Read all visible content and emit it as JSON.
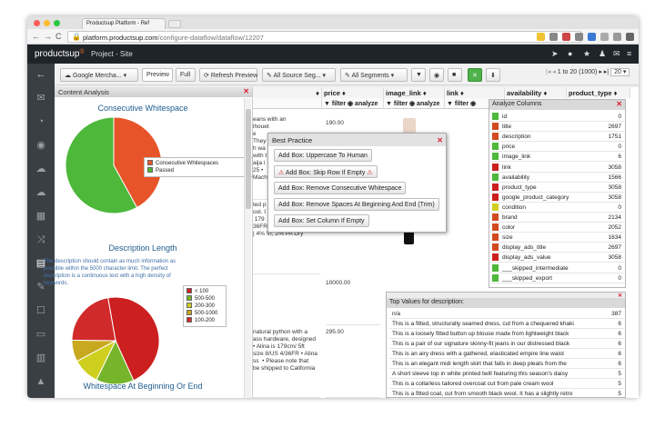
{
  "browser": {
    "tab_title": "Productsup Platform - Ref",
    "url": "platform.productsup.com/configure-dataflow/dataflow/12207",
    "url_host": "platform.productsup.com",
    "url_path": "/configure-dataflow/dataflow/12207"
  },
  "header": {
    "logo": "productsup",
    "logo_mark": "®",
    "project": "Project - Site"
  },
  "toolbar": {
    "channel": "Google Mercha...",
    "preview": "Preview",
    "full": "Full",
    "refresh": "Refresh Preview",
    "all_source": "All Source Seg...",
    "all_segments": "All Segments",
    "paging": "1 to 20 (1000)",
    "per_page": "20"
  },
  "content_analysis": {
    "title": "Content Analysis",
    "section1": {
      "title": "Consecutive Whitespace",
      "legend": [
        {
          "label": "Consecutive Whitespaces",
          "color": "#e8542a"
        },
        {
          "label": "Passed",
          "color": "#4db83a"
        }
      ],
      "values": [
        42,
        58
      ]
    },
    "section2": {
      "title": "Description Length",
      "text": "The description should contain as much information as possible within the 5000 character limit. The perfect description is a continuous text with a high density of keywords.",
      "legend": [
        {
          "label": "< 100",
          "color": "#cc1f1f"
        },
        {
          "label": "500-500",
          "color": "#76b52a"
        },
        {
          "label": "200-300",
          "color": "#cfcf1f"
        },
        {
          "label": "500-1000",
          "color": "#c8a81e"
        },
        {
          "label": "100-200",
          "color": "#d02a2a"
        }
      ],
      "values": [
        46,
        14,
        10,
        8,
        22
      ]
    },
    "section3": {
      "title": "Whitespace At Beginning Or End"
    }
  },
  "grid": {
    "columns": [
      {
        "label": "price"
      },
      {
        "label": "image_link"
      },
      {
        "label": "link"
      },
      {
        "label": "availability"
      },
      {
        "label": "product_type"
      }
    ],
    "filter_label": "filter",
    "analyze_label": "analyze",
    "left_text_1": "eans with an\nlhouet\ne\nThey\nh wa\nwith t\naija i\n25 •\nMach",
    "left_text_2": "ted p\nool. I\n 179\n36FR True to size fit\n| 4% VI, 2% PA Dry",
    "left_text_3": "natural python with a\nass hardware, designed\n• Alina is 179cm/ 5ft\nsize 8/US 4/36FR • Alina\nss  • Please note that\nbe shipped to California",
    "price_1": "190.00",
    "price_2": "10000.00",
    "price_3": "295.00"
  },
  "best_practice": {
    "title": "Best Practice",
    "buttons": [
      "Add Box: Uppercase To Human",
      "Add Box: Skip Row If Empty",
      "Add Box: Remove Consecutive Whitespace",
      "Add Box: Remove Spaces At Beginning And End (Trim)",
      "Add Box: Set Column If Empty"
    ]
  },
  "analyze_columns": {
    "title": "Analyze Columns",
    "rows": [
      {
        "name": "id",
        "value": "0",
        "color": "#4db83a"
      },
      {
        "name": "title",
        "value": "2697",
        "color": "#d24a1f"
      },
      {
        "name": "description",
        "value": "1751",
        "color": "#d24a1f"
      },
      {
        "name": "price",
        "value": "0",
        "color": "#4db83a"
      },
      {
        "name": "image_link",
        "value": "6",
        "color": "#4db83a"
      },
      {
        "name": "link",
        "value": "3058",
        "color": "#cc1f1f"
      },
      {
        "name": "availability",
        "value": "1566",
        "color": "#4db83a"
      },
      {
        "name": "product_type",
        "value": "3058",
        "color": "#cc1f1f"
      },
      {
        "name": "google_product_category",
        "value": "3058",
        "color": "#cc1f1f"
      },
      {
        "name": "condition",
        "value": "0",
        "color": "#cfcf1f"
      },
      {
        "name": "brand",
        "value": "2134",
        "color": "#d24a1f"
      },
      {
        "name": "color",
        "value": "2052",
        "color": "#d24a1f"
      },
      {
        "name": "size",
        "value": "1634",
        "color": "#d24a1f"
      },
      {
        "name": "display_ads_title",
        "value": "2697",
        "color": "#d24a1f"
      },
      {
        "name": "display_ads_value",
        "value": "3058",
        "color": "#cc1f1f"
      },
      {
        "name": "___skipped_intermediate",
        "value": "0",
        "color": "#4db83a"
      },
      {
        "name": "___skipped_export",
        "value": "0",
        "color": "#4db83a"
      }
    ]
  },
  "top_values": {
    "title": "Top Values for description:",
    "rows": [
      {
        "text": "n/a",
        "count": "387"
      },
      {
        "text": "This is a fitted, structurally seamed dress, cut from a chequered khaki",
        "count": "6"
      },
      {
        "text": "This is a loosely fitted button up blouse made from lightweight black",
        "count": "6"
      },
      {
        "text": "This is a pair of our signature skinny-fit jeans in our distressed black",
        "count": "6"
      },
      {
        "text": "This is an airy dress with a gathered, elasticated empire line waist",
        "count": "6"
      },
      {
        "text": "This is an elegant midi length skirt that falls in deep pleats from the",
        "count": "6"
      },
      {
        "text": "A short sleeve top in white printed twill featuring this season's daisy",
        "count": "5"
      },
      {
        "text": "This is a collarless tailored overcoat cut from pale cream wool",
        "count": "5"
      },
      {
        "text": "This is a fitted coat, cut from smooth black wool. It has a slightly retro",
        "count": "5"
      }
    ]
  }
}
